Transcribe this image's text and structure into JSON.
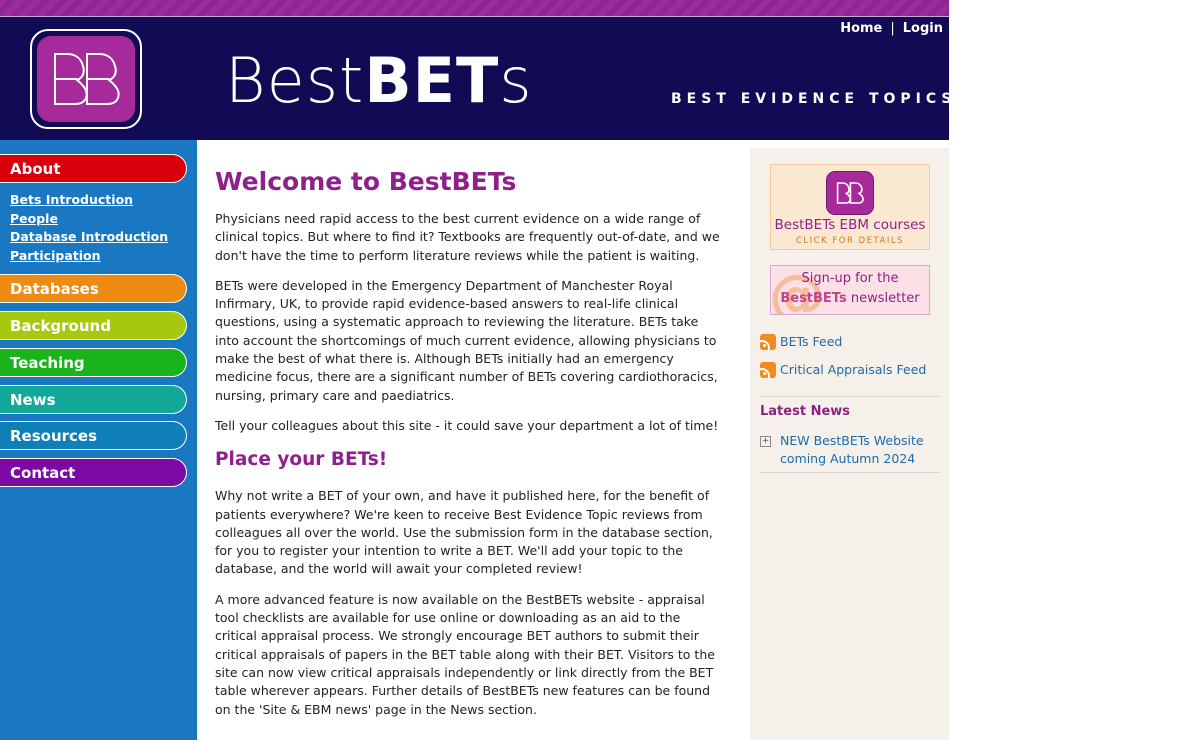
{
  "header": {
    "wordmark_light": "Best",
    "wordmark_bold": "BET",
    "wordmark_tail": "s",
    "tagline": "BEST EVIDENCE TOPICS",
    "nav": {
      "home": "Home",
      "separator": "|",
      "login": "Login"
    }
  },
  "sidebar": {
    "sections": [
      {
        "label": "About",
        "color": "#d8000c"
      },
      {
        "label": "Databases",
        "color": "#ee8b12"
      },
      {
        "label": "Background",
        "color": "#a6c90f"
      },
      {
        "label": "Teaching",
        "color": "#1bb31b"
      },
      {
        "label": "News",
        "color": "#13a89a"
      },
      {
        "label": "Resources",
        "color": "#0f7fb8"
      },
      {
        "label": "Contact",
        "color": "#7a0aa3"
      }
    ],
    "about_links": [
      "Bets Introduction",
      "People",
      "Database Introduction",
      "Participation"
    ]
  },
  "main": {
    "title": "Welcome to BestBETs",
    "para1": "Physicians need rapid access to the best current evidence on a wide range of clinical topics. But where to find it? Textbooks are frequently out-of-date, and we don't have the time to perform literature reviews while the patient is waiting.",
    "para2": "BETs were developed in the Emergency Department of Manchester Royal Infirmary, UK, to provide rapid evidence-based answers to real-life clinical questions, using a systematic approach to reviewing the literature. BETs take into account the shortcomings of much current evidence, allowing physicians to make the best of what there is. Although BETs initially had an emergency medicine focus, there are a significant number of BETs covering cardiothoracics, nursing, primary care and paediatrics.",
    "para3": "Tell your colleagues about this site - it could save your department a lot of time!",
    "subtitle": "Place your BETs!",
    "para4": "Why not write a BET of your own, and have it published here, for the benefit of patients everywhere? We're keen to receive Best Evidence Topic reviews from colleagues all over the world. Use the submission form in the database section, for you to register your intention to write a BET. We'll add your topic to the database, and the world will await your completed review!",
    "para5": "A more advanced feature is now available on the BestBETs website - appraisal tool checklists are available for use online or downloading as an aid to the critical appraisal process. We strongly encourage BET authors to submit their critical appraisals of papers in the BET table along with their BET. Visitors to the site can now view critical appraisals independently or link directly from the BET table wherever appears. Further details of BestBETs new features can be found on the 'Site & EBM news' page in the News section."
  },
  "right": {
    "ebm_banner": {
      "title": "BestBETs EBM courses",
      "sub": "CLICK FOR DETAILS"
    },
    "newsletter_banner": {
      "line1": "Sign-up for the",
      "brand": "BestBETs",
      "line2_tail": "newsletter"
    },
    "feeds": [
      "BETs Feed",
      "Critical Appraisals Feed"
    ],
    "latest_news_title": "Latest News",
    "news_items": [
      "NEW BestBETs Website coming Autumn 2024"
    ]
  }
}
